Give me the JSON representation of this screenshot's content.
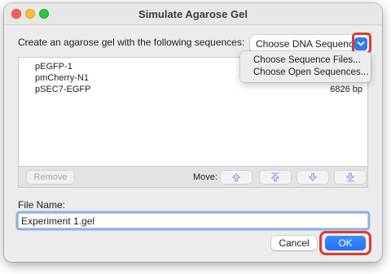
{
  "window": {
    "title": "Simulate Agarose Gel"
  },
  "prompt": "Create an agarose gel with the following sequences:",
  "popup": {
    "label": "Choose DNA Sequences"
  },
  "menu": {
    "items": [
      "Choose Sequence Files...",
      "Choose Open Sequences..."
    ]
  },
  "sequences": [
    {
      "name": "pEGFP-1",
      "size": ""
    },
    {
      "name": "pmCherry-N1",
      "size": ""
    },
    {
      "name": "pSEC7-EGFP",
      "size": "6826 bp"
    }
  ],
  "toolbar": {
    "remove_label": "Remove",
    "move_label": "Move:"
  },
  "file_name": {
    "label": "File Name:",
    "value": "Experiment 1.gel"
  },
  "buttons": {
    "cancel": "Cancel",
    "ok": "OK"
  },
  "colors": {
    "accent": "#2f7bf6",
    "highlight": "#e03a2c"
  }
}
